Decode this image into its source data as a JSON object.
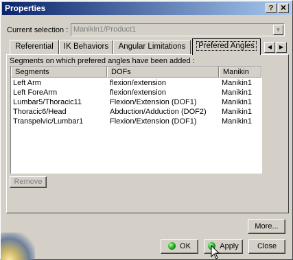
{
  "window": {
    "title": "Properties",
    "help_glyph": "?",
    "close_glyph": "✕"
  },
  "current_selection": {
    "label": "Current selection :",
    "value": "Manikin1/Product1",
    "arrow_glyph": "▼"
  },
  "tabs": [
    {
      "label": "Referential",
      "active": false
    },
    {
      "label": "IK Behaviors",
      "active": false
    },
    {
      "label": "Angular Limitations",
      "active": false
    },
    {
      "label": "Prefered Angles",
      "active": true
    }
  ],
  "tab_scroll": {
    "left_glyph": "◀",
    "right_glyph": "▶"
  },
  "panel": {
    "label": "Segments on which prefered angles have been added :"
  },
  "list": {
    "columns": [
      "Segments",
      "DOFs",
      "Manikin"
    ],
    "rows": [
      {
        "segment": "Left Arm",
        "dof": "flexion/extension",
        "manikin": "Manikin1"
      },
      {
        "segment": "Left ForeArm",
        "dof": "flexion/extension",
        "manikin": "Manikin1"
      },
      {
        "segment": "Lumbar5/Thoracic11",
        "dof": "Flexion/Extension (DOF1)",
        "manikin": "Manikin1"
      },
      {
        "segment": "Thoracic6/Head",
        "dof": "Abduction/Adduction (DOF2)",
        "manikin": "Manikin1"
      },
      {
        "segment": "Transpelvic/Lumbar1",
        "dof": "Flexion/Extension (DOF1)",
        "manikin": "Manikin1"
      }
    ]
  },
  "buttons": {
    "remove": "Remove",
    "more": "More...",
    "ok": "OK",
    "apply": "Apply",
    "close": "Close"
  },
  "colors": {
    "titlebar_start": "#0a246a",
    "titlebar_end": "#a6caf0",
    "dialog_bg": "#d4d0c8"
  }
}
